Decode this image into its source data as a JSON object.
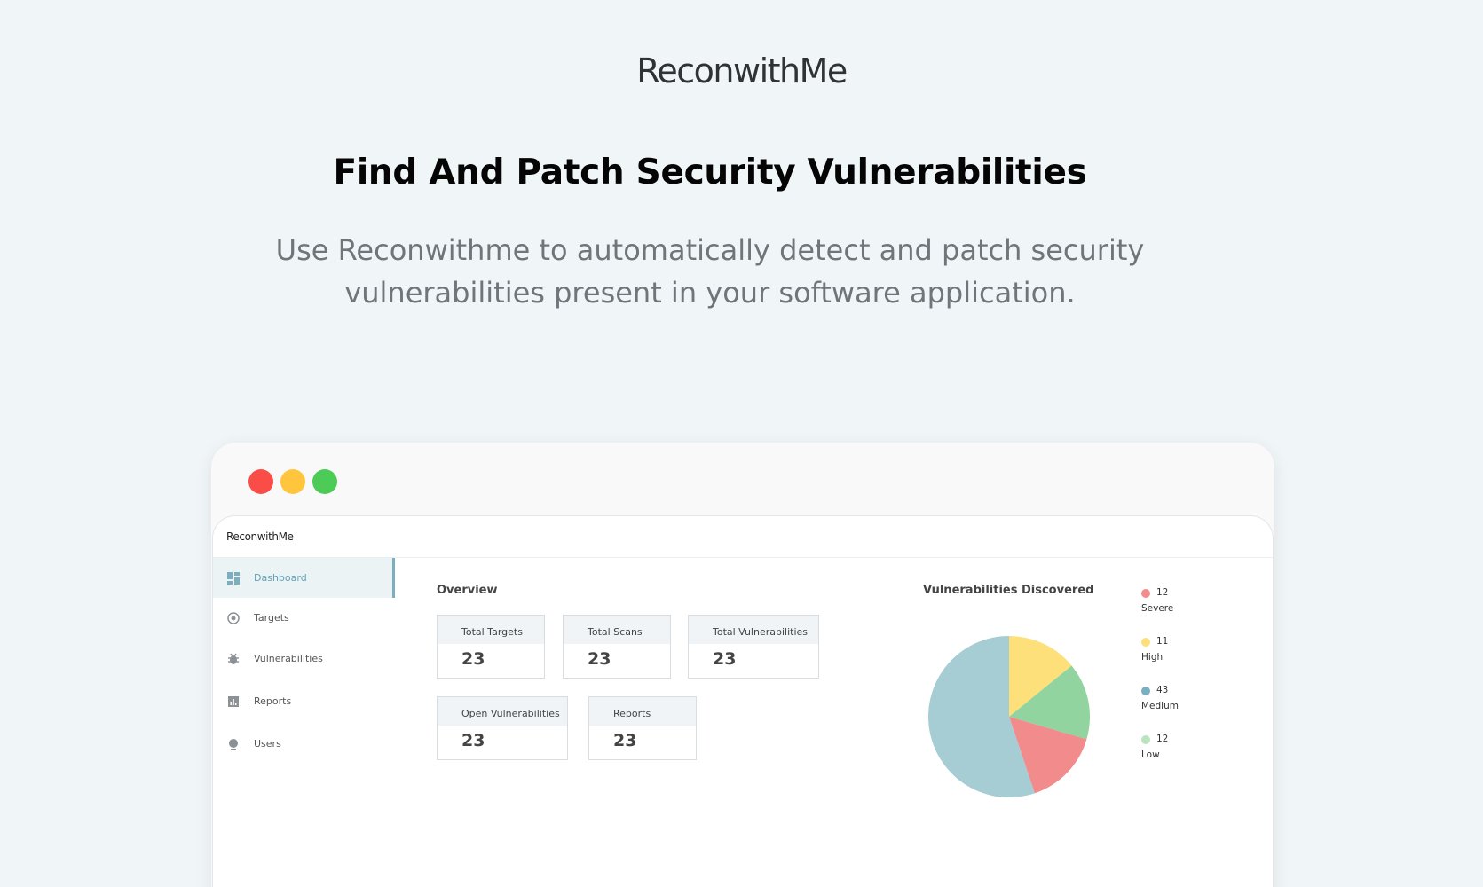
{
  "hero": {
    "brand": "ReconwithMe",
    "headline": "Find And Patch Security Vulnerabilities",
    "subline_1": "Use Reconwithme to automatically detect and patch security",
    "subline_2": "vulnerabilities present in your software application."
  },
  "app": {
    "title": "ReconwithMe",
    "sidebar": {
      "items": [
        {
          "label": "Dashboard",
          "icon": "dashboard-icon",
          "active": true
        },
        {
          "label": "Targets",
          "icon": "target-icon",
          "active": false
        },
        {
          "label": "Vulnerabilities",
          "icon": "bug-icon",
          "active": false
        },
        {
          "label": "Reports",
          "icon": "reports-icon",
          "active": false
        },
        {
          "label": "Users",
          "icon": "user-icon",
          "active": false
        }
      ]
    },
    "overview": {
      "title": "Overview",
      "cards": [
        {
          "label": "Total Targets",
          "value": "23"
        },
        {
          "label": "Total Scans",
          "value": "23"
        },
        {
          "label": "Total Vulnerabilities",
          "value": "23"
        },
        {
          "label": "Open Vulnerabilities",
          "value": "23"
        },
        {
          "label": "Reports",
          "value": "23"
        }
      ]
    },
    "vulns_title": "Vulnerabilities Discovered"
  },
  "colors": {
    "severe": "#f28b8b",
    "high": "#fde07a",
    "medium": "#a6ccd4",
    "low": "#91d4a0",
    "accent": "#5ea2b6"
  },
  "chart_data": {
    "type": "pie",
    "title": "Vulnerabilities Discovered",
    "legend_position": "right",
    "slices": [
      {
        "name": "Severe",
        "value": 12,
        "color": "#f28b8b"
      },
      {
        "name": "High",
        "value": 11,
        "color": "#fde07a"
      },
      {
        "name": "Medium",
        "value": 43,
        "color": "#a6ccd4"
      },
      {
        "name": "Low",
        "value": 12,
        "color": "#91d4a0"
      }
    ],
    "legend": [
      {
        "name": "Severe",
        "value": "12",
        "color": "#f28b8b"
      },
      {
        "name": "High",
        "value": "11",
        "color": "#fde07a"
      },
      {
        "name": "Medium",
        "value": "43",
        "color": "#7bafc0"
      },
      {
        "name": "Low",
        "value": "12",
        "color": "#b9e4bd"
      }
    ]
  }
}
